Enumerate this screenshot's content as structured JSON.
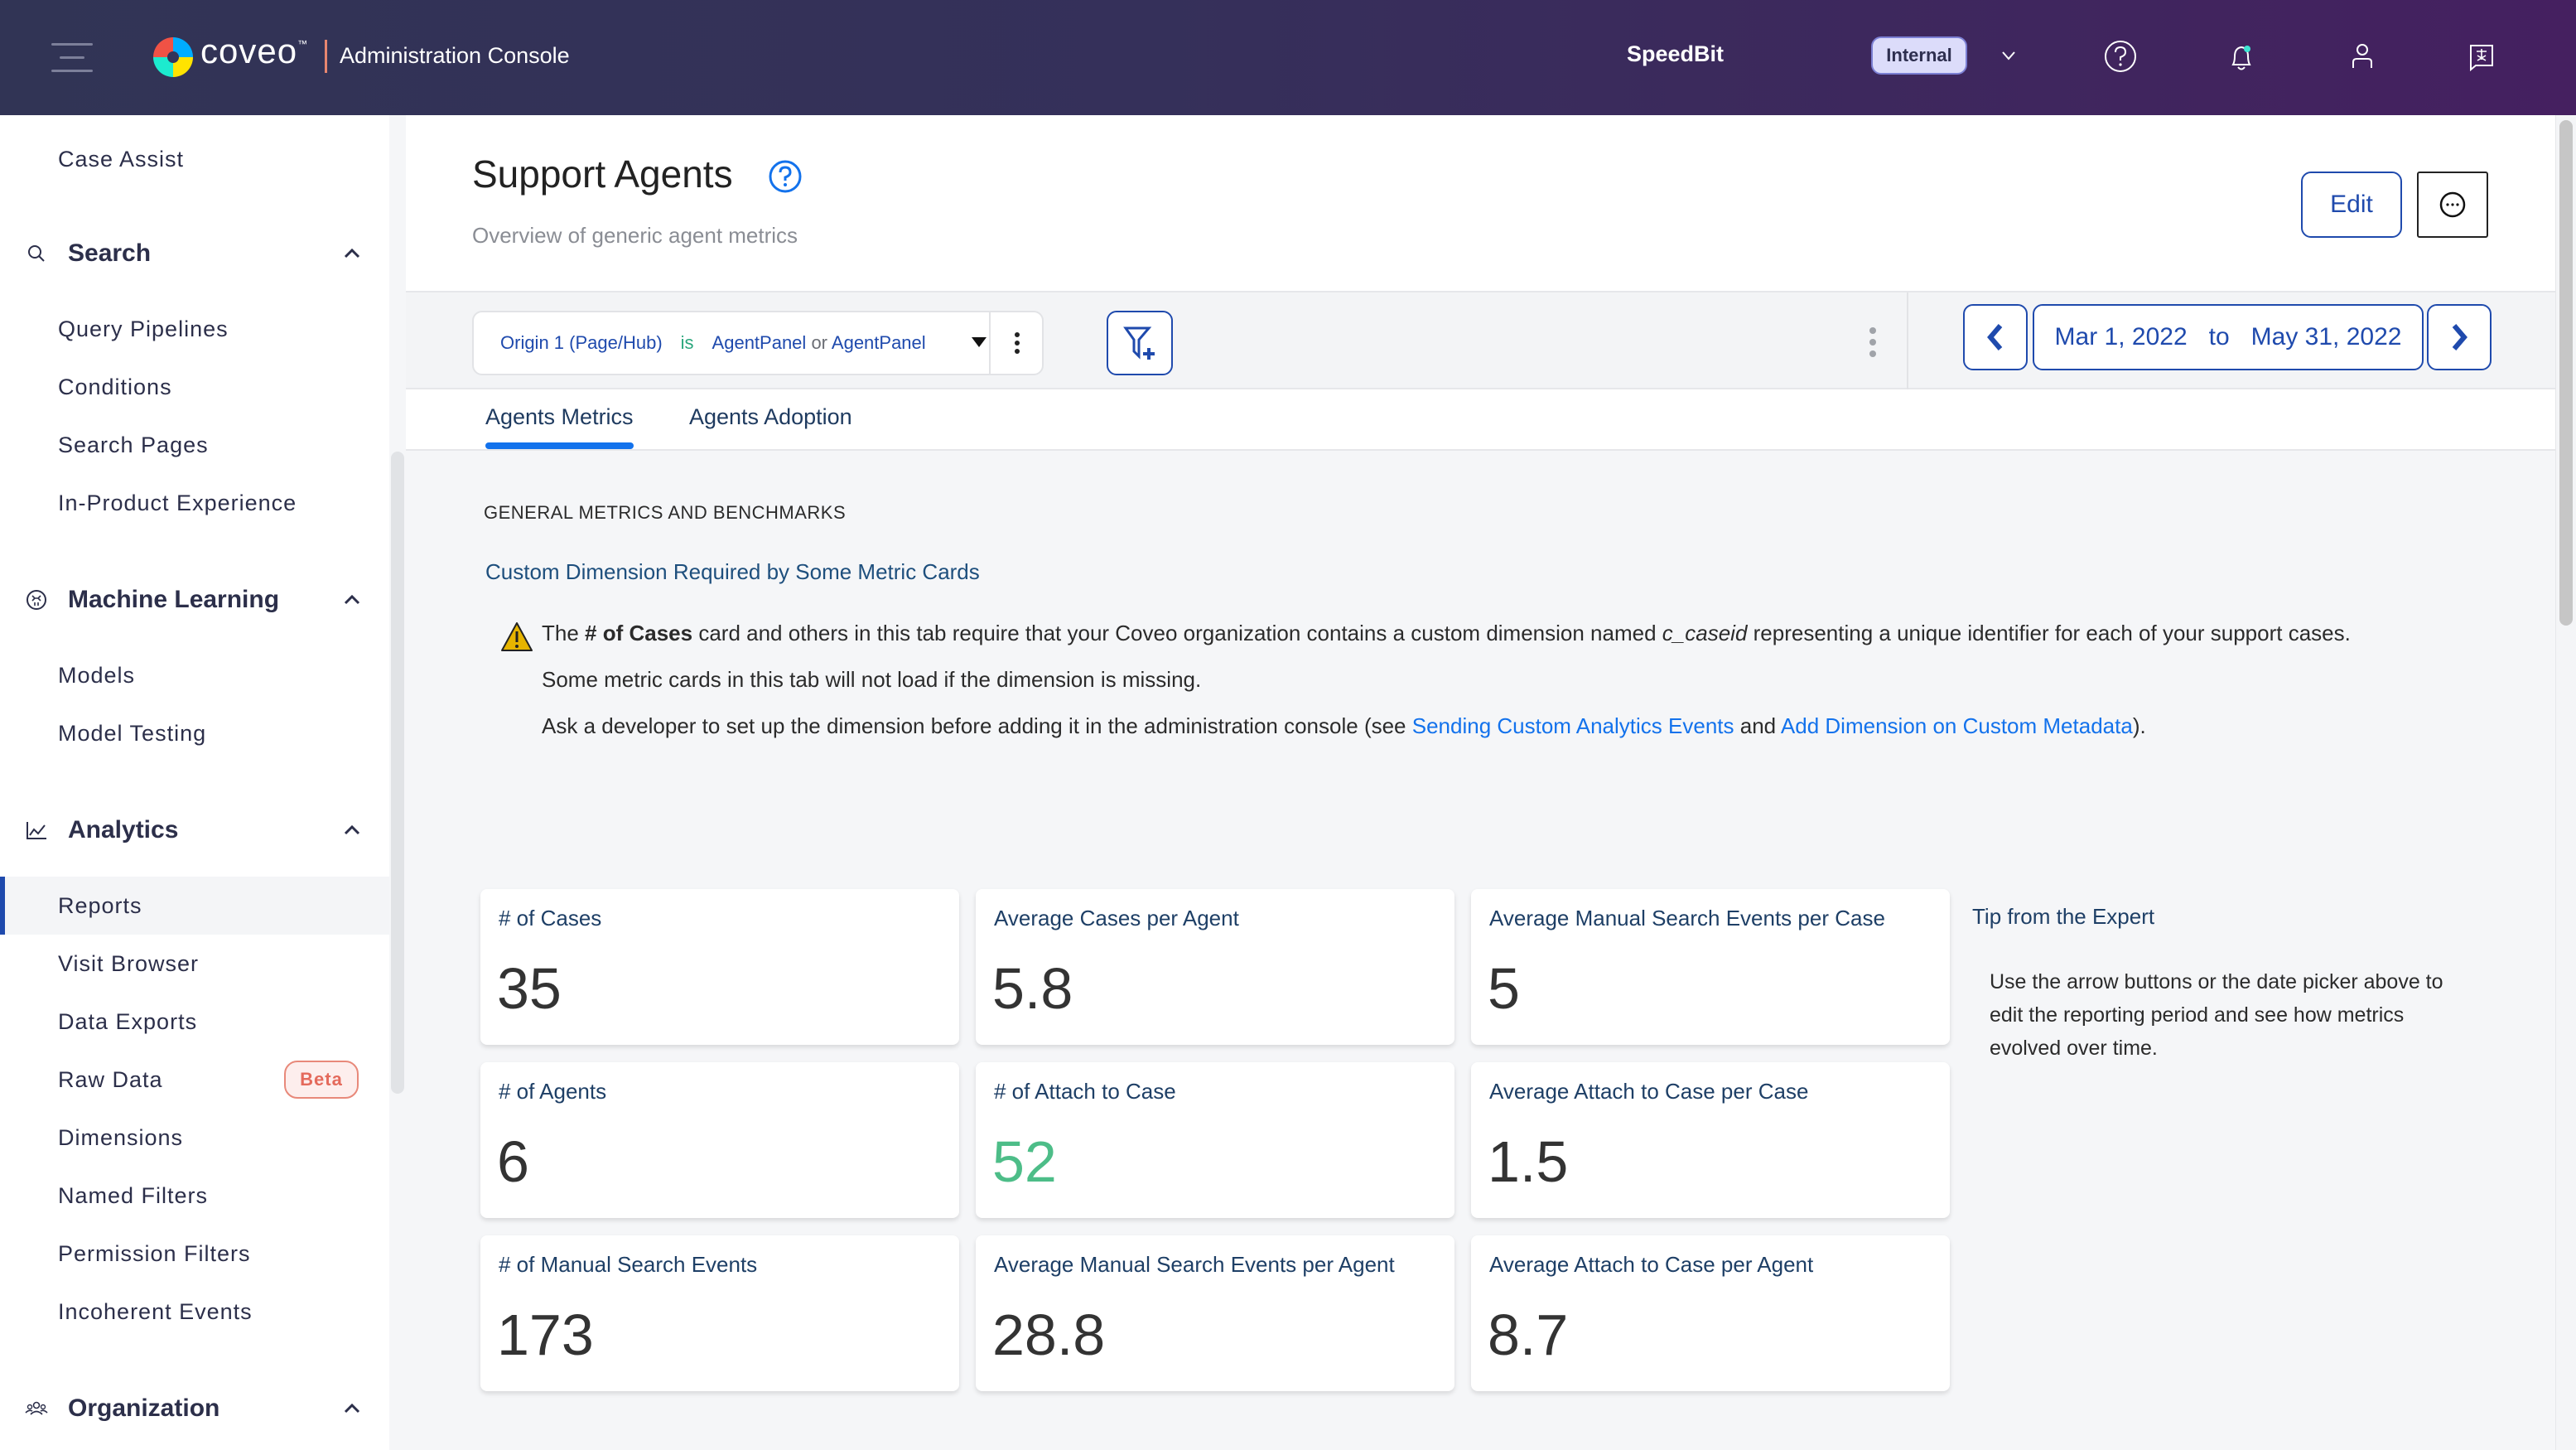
{
  "topbar": {
    "brand": "coveo",
    "brand_tm": "™",
    "app_title": "Administration Console",
    "org_name": "SpeedBit",
    "env_badge": "Internal",
    "icons": [
      "menu-icon",
      "help-icon",
      "notifications-icon",
      "user-icon",
      "translate-icon"
    ]
  },
  "sidebar": {
    "top_items": [
      {
        "label": "Case Assist"
      }
    ],
    "sections": [
      {
        "label": "Search",
        "icon": "search-icon",
        "items": [
          {
            "label": "Query Pipelines"
          },
          {
            "label": "Conditions"
          },
          {
            "label": "Search Pages"
          },
          {
            "label": "In-Product Experience"
          }
        ]
      },
      {
        "label": "Machine Learning",
        "icon": "brain-icon",
        "items": [
          {
            "label": "Models"
          },
          {
            "label": "Model Testing"
          }
        ]
      },
      {
        "label": "Analytics",
        "icon": "chart-line-icon",
        "items": [
          {
            "label": "Reports",
            "active": true
          },
          {
            "label": "Visit Browser"
          },
          {
            "label": "Data Exports"
          },
          {
            "label": "Raw Data",
            "badge": "Beta"
          },
          {
            "label": "Dimensions"
          },
          {
            "label": "Named Filters"
          },
          {
            "label": "Permission Filters"
          },
          {
            "label": "Incoherent Events"
          }
        ]
      },
      {
        "label": "Organization",
        "icon": "people-icon",
        "items": []
      }
    ]
  },
  "page": {
    "title": "Support Agents",
    "subtitle": "Overview of generic agent metrics",
    "edit_label": "Edit"
  },
  "filter": {
    "dimension": "Origin 1 (Page/Hub)",
    "operator": "is",
    "value1": "AgentPanel",
    "conjunction": "or",
    "value2": "AgentPanel"
  },
  "date_range": {
    "start": "Mar 1, 2022",
    "separator": "to",
    "end": "May 31, 2022"
  },
  "tabs": [
    {
      "label": "Agents Metrics",
      "active": true
    },
    {
      "label": "Agents Adoption",
      "active": false
    }
  ],
  "content": {
    "section_label": "GENERAL METRICS AND BENCHMARKS",
    "notice": {
      "title": "Custom Dimension Required by Some Metric Cards",
      "line1_pre": "The ",
      "line1_bold": "# of Cases",
      "line1_mid": " card and others in this tab require that your Coveo organization contains a custom dimension named ",
      "line1_italic": "c_caseid",
      "line1_post": " representing a unique identifier for each of your support cases.",
      "line2": "Some metric cards in this tab will not load if the dimension is missing.",
      "line3_pre": "Ask a developer to set up the dimension before adding it in the administration console (see ",
      "link1": "Sending Custom Analytics Events",
      "line3_and": " and ",
      "link2": "Add Dimension on Custom Metadata",
      "line3_post": ")."
    },
    "cards": [
      {
        "title": "# of Cases",
        "value": "35"
      },
      {
        "title": "Average Cases per Agent",
        "value": "5.8"
      },
      {
        "title": "Average Manual Search Events per Case",
        "value": "5"
      },
      {
        "title": "# of Agents",
        "value": "6"
      },
      {
        "title": "# of Attach to Case",
        "value": "52",
        "accent": true
      },
      {
        "title": "Average Attach to Case per Case",
        "value": "1.5"
      },
      {
        "title": "# of Manual Search Events",
        "value": "173"
      },
      {
        "title": "Average Manual Search Events per Agent",
        "value": "28.8"
      },
      {
        "title": "Average Attach to Case per Agent",
        "value": "8.7"
      }
    ],
    "tip": {
      "title": "Tip from the Expert",
      "body": "Use the arrow buttons or the date picker above to edit the reporting period and see how metrics evolved over time."
    }
  },
  "colors": {
    "primary": "#1f4aad",
    "link": "#1372ec",
    "accent_value": "#4dbd88",
    "beta": "#e46a5c"
  }
}
